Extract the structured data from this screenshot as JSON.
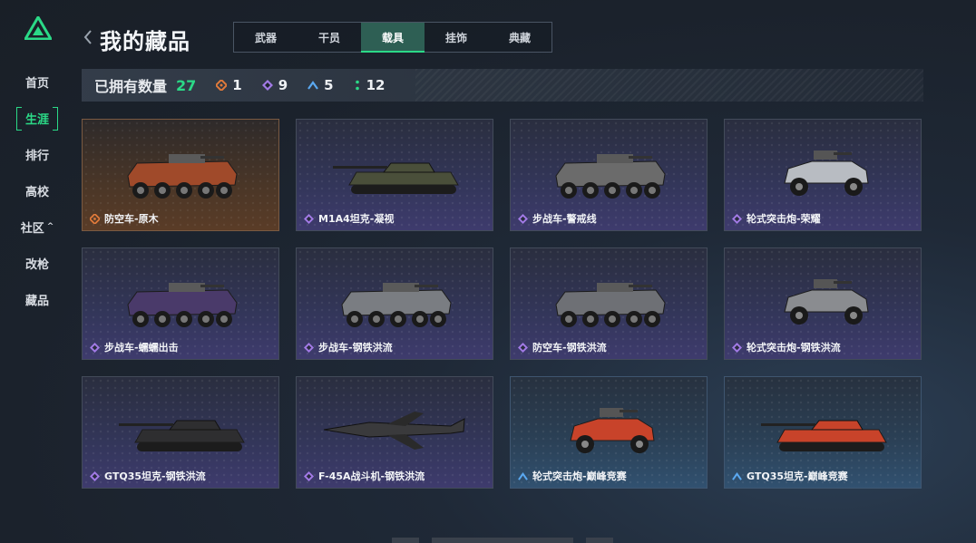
{
  "sidebar": {
    "items": [
      {
        "label": "首页"
      },
      {
        "label": "生涯",
        "active": true
      },
      {
        "label": "排行"
      },
      {
        "label": "高校"
      },
      {
        "label": "社区",
        "caret": "^"
      },
      {
        "label": "改枪"
      },
      {
        "label": "藏品"
      }
    ]
  },
  "header": {
    "title": "我的藏品",
    "tabs": [
      {
        "label": "武器"
      },
      {
        "label": "干员"
      },
      {
        "label": "载具",
        "active": true
      },
      {
        "label": "挂饰"
      },
      {
        "label": "典藏"
      }
    ]
  },
  "stats": {
    "label": "已拥有数量",
    "total": "27",
    "rarities": [
      {
        "icon": "diamond-orange-icon",
        "color": "#e07a3a",
        "count": "1"
      },
      {
        "icon": "diamond-purple-icon",
        "color": "#a27ae6",
        "count": "9"
      },
      {
        "icon": "chevron-blue-icon",
        "color": "#5aa8f0",
        "count": "5"
      },
      {
        "icon": "dots-green-icon",
        "color": "#2bd987",
        "count": "12"
      }
    ]
  },
  "cards": [
    {
      "name": "防空车-原木",
      "rarity": "orange"
    },
    {
      "name": "M1A4坦克-凝视",
      "rarity": "purple"
    },
    {
      "name": "步战车-警戒线",
      "rarity": "purple"
    },
    {
      "name": "轮式突击炮-荣耀",
      "rarity": "purple"
    },
    {
      "name": "步战车-蠕蠕出击",
      "rarity": "purple"
    },
    {
      "name": "步战车-钢铁洪流",
      "rarity": "purple"
    },
    {
      "name": "防空车-钢铁洪流",
      "rarity": "purple"
    },
    {
      "name": "轮式突击炮-钢铁洪流",
      "rarity": "purple"
    },
    {
      "name": "GTQ35坦克-钢铁洪流",
      "rarity": "purple"
    },
    {
      "name": "F-45A战斗机-钢铁洪流",
      "rarity": "purple"
    },
    {
      "name": "轮式突击炮-巅峰竞赛",
      "rarity": "blue"
    },
    {
      "name": "GTQ35坦克-巅峰竞赛",
      "rarity": "blue"
    }
  ],
  "colors": {
    "accent": "#2bd987",
    "orange": "#e07a3a",
    "purple": "#a27ae6",
    "blue": "#5aa8f0"
  }
}
